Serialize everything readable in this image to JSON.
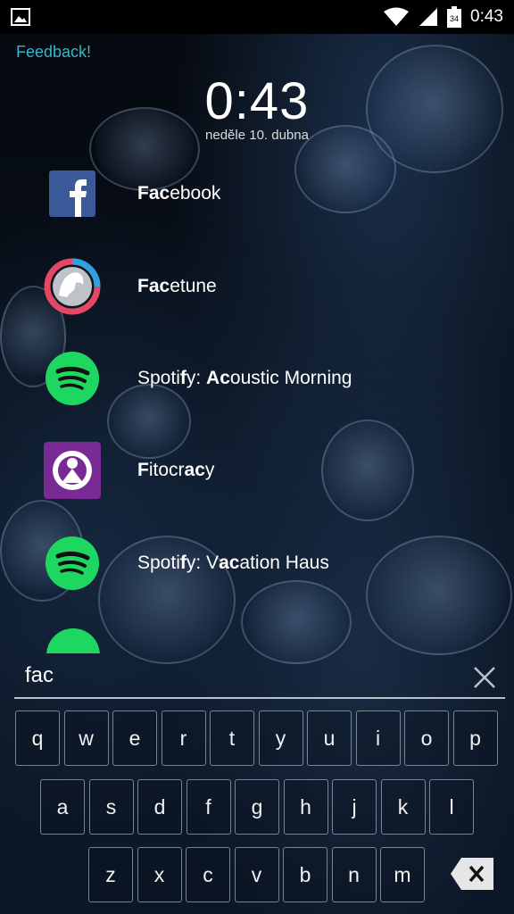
{
  "status": {
    "time": "0:43",
    "battery": "34"
  },
  "feedback": "Feedback!",
  "clock": "0:43",
  "date": "neděle 10. dubna",
  "results": [
    {
      "parts": [
        [
          "Fac",
          true
        ],
        [
          "ebook",
          false
        ]
      ],
      "icon": "facebook-icon"
    },
    {
      "parts": [
        [
          "Fac",
          true
        ],
        [
          "etune",
          false
        ]
      ],
      "icon": "facetune-icon"
    },
    {
      "parts": [
        [
          "Spoti",
          false
        ],
        [
          "f",
          true
        ],
        [
          "y: ",
          false
        ],
        [
          "Ac",
          true
        ],
        [
          "oustic Morning",
          false
        ]
      ],
      "icon": "spotify-icon"
    },
    {
      "parts": [
        [
          "F",
          true
        ],
        [
          "itocr",
          false
        ],
        [
          "ac",
          true
        ],
        [
          "y",
          false
        ]
      ],
      "icon": "fitocracy-icon"
    },
    {
      "parts": [
        [
          "Spoti",
          false
        ],
        [
          "f",
          true
        ],
        [
          "y: V",
          false
        ],
        [
          "ac",
          true
        ],
        [
          "ation Haus",
          false
        ]
      ],
      "icon": "spotify-icon"
    }
  ],
  "search": {
    "value": "fac"
  },
  "keyboard": {
    "row1": [
      "q",
      "w",
      "e",
      "r",
      "t",
      "y",
      "u",
      "i",
      "o",
      "p"
    ],
    "row2": [
      "a",
      "s",
      "d",
      "f",
      "g",
      "h",
      "j",
      "k",
      "l"
    ],
    "row3": [
      "z",
      "x",
      "c",
      "v",
      "b",
      "n",
      "m"
    ]
  },
  "colors": {
    "accent": "#36b6c6",
    "facebook": "#3b5998",
    "spotify": "#1ed760",
    "fitocracy": "#7a2a94"
  }
}
